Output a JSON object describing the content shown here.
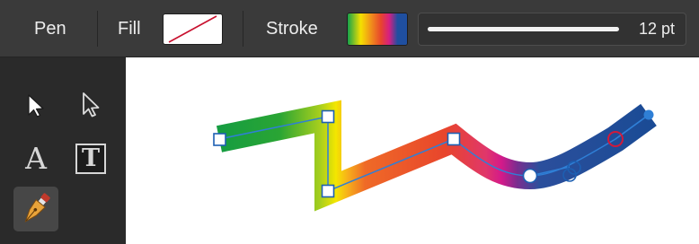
{
  "toolbar": {
    "tool_name": "Pen",
    "fill_label": "Fill",
    "fill_swatch": {
      "state": "none",
      "slash_color": "#c8102e"
    },
    "stroke_label": "Stroke",
    "stroke_swatch": {
      "type": "gradient",
      "colors": [
        "#16a34a",
        "#f5e000",
        "#e8452c",
        "#d61f82",
        "#1f4fa0"
      ]
    },
    "stroke_width": "12 pt"
  },
  "tools": [
    {
      "name": "move-tool",
      "icon": "arrow-filled-icon",
      "active": false
    },
    {
      "name": "node-tool",
      "icon": "arrow-outline-icon",
      "active": false
    },
    {
      "name": "artistic-text-tool",
      "icon": "letter-a-icon",
      "glyph": "A",
      "active": false
    },
    {
      "name": "frame-text-tool",
      "icon": "framed-t-icon",
      "glyph": "T",
      "active": false
    },
    {
      "name": "pen-tool",
      "icon": "pen-nib-icon",
      "active": true
    }
  ],
  "canvas": {
    "path_gradient": [
      "#0e9a46",
      "#f2e500",
      "#e8452c",
      "#d61f82",
      "#1c4e9a"
    ],
    "curve_color": "#2f7fd6",
    "selected_node_color": "#d11a3a"
  }
}
